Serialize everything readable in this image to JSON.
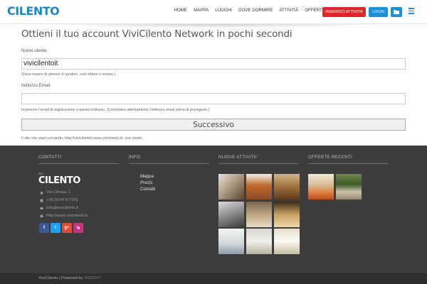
{
  "header": {
    "logo_small": "VIVI",
    "logo_main": "CILENTO",
    "nav": [
      "HOME",
      "MAPPA",
      "LUOGHI",
      "DOVE DORMIRE",
      "ATTIVITÀ",
      "OFFERTE"
    ],
    "insert_button": "INSERISCI ATTIVITÀ",
    "login_button": "LOGIN",
    "colors": {
      "red": "#e0262a",
      "blue": "#1e90d8"
    }
  },
  "form": {
    "title": "Ottieni il tuo account ViviCilento Network in pochi secondi",
    "username_label": "Nome utente:",
    "username_value": "vivicilentoit",
    "username_hint": "(Deve essere di almeno 4 caratteri, solo lettere e numeri.)",
    "email_label": "Indirizzo Email:",
    "email_value": "",
    "email_hint": "Invieremo l'email di registrazione a questo indirizzo. (Controllare attentamente l'indirizzo email prima di proseguire.)",
    "next_button": "Successivo",
    "not_found_note": "Il sito che stavi cercando, http://vivicilentoit.www.vivicilento.it/, non esiste."
  },
  "footer": {
    "contatti_title": "CONTATTI",
    "info_title": "INFO",
    "nuove_title": "NUOVE ATTIVITA'",
    "offerte_title": "OFFERTE RECENTI",
    "logo_small": "VIVI",
    "logo_main": "CILENTO",
    "address": "Via Chiusa, 1",
    "phone": "+39 0974 977201",
    "email": "info@vivicilento.it",
    "website": "http://www.vivicilento.it",
    "social": [
      "f",
      "t",
      "g+",
      "ig"
    ],
    "info_links": [
      "Mappa",
      "Prezzi",
      "Contatti"
    ],
    "copyright": "ViviCilento | Powered by",
    "powered_by": "INSIGHT"
  }
}
